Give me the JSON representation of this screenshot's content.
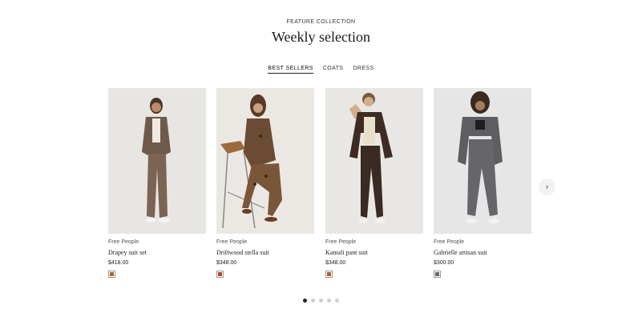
{
  "header": {
    "eyebrow": "FEATURE COLLECTION",
    "title": "Weekly selection"
  },
  "tabs": [
    {
      "label": "BEST SELLERS",
      "active": true
    },
    {
      "label": "COATS",
      "active": false
    },
    {
      "label": "DRESS",
      "active": false
    }
  ],
  "products": [
    {
      "brand": "Free People",
      "name": "Drapey suit set",
      "price": "$418.00",
      "swatch_color": "#b5652a",
      "image": "woman-brown-suit-photo"
    },
    {
      "brand": "Free People",
      "name": "Driftwood stella suit",
      "price": "$348.00",
      "swatch_color": "#a04e25",
      "image": "woman-patterned-suit-on-chair-photo"
    },
    {
      "brand": "Free People",
      "name": "Kamali pant suit",
      "price": "$348.00",
      "swatch_color": "#b45c25",
      "image": "woman-dark-suit-photo"
    },
    {
      "brand": "Free People",
      "name": "Gabrielle artisan suit",
      "price": "$300.00",
      "swatch_color": "#6b6b6b",
      "image": "woman-grey-suit-photo"
    }
  ],
  "carousel": {
    "next_icon": "chevron-right-icon",
    "dots_count": 5,
    "active_dot": 0
  }
}
